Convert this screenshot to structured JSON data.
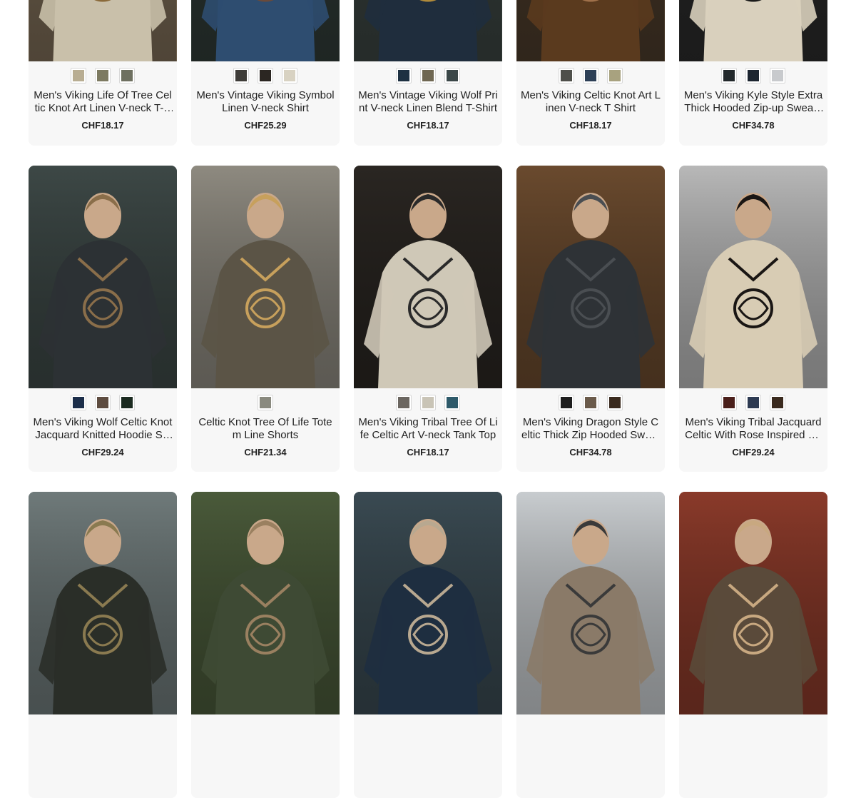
{
  "rows": [
    {
      "cards": [
        {
          "title": "Men's Viking Life Of Tree Celtic Knot Art Linen V-neck T-Shirt",
          "price": "CHF18.17",
          "swatches": [
            "#b8ad92",
            "#7d7a61",
            "#6e7060"
          ],
          "img": {
            "bg": "#7a6a55",
            "body": "#c9c0aa",
            "accent": "#8a6a3a",
            "icon": "viking-tree-linen-shirt-image"
          }
        },
        {
          "title": "Men's Vintage Viking Symbol Linen V-neck Shirt",
          "price": "CHF25.29",
          "swatches": [
            "#3e3c38",
            "#2b2622",
            "#d8d2c2"
          ],
          "img": {
            "bg": "#2f3a36",
            "body": "#2e4d70",
            "accent": "#6a4a3a",
            "icon": "viking-symbol-shirt-image"
          }
        },
        {
          "title": "Men's Vintage Viking Wolf Print V-neck Linen Blend T-Shirt",
          "price": "CHF18.17",
          "swatches": [
            "#1e3142",
            "#6f6752",
            "#3b4748"
          ],
          "img": {
            "bg": "#3a4340",
            "body": "#1f2d3d",
            "accent": "#b08a3a",
            "icon": "viking-wolf-print-shirt-image"
          }
        },
        {
          "title": "Men's Viking Celtic Knot Art Linen V-neck T Shirt",
          "price": "CHF18.17",
          "swatches": [
            "#4e4f4a",
            "#2d3f56",
            "#a8a27f"
          ],
          "img": {
            "bg": "#4a3a2a",
            "body": "#5a3a1e",
            "accent": "#a0704a",
            "icon": "viking-celtic-knot-shirt-image"
          }
        },
        {
          "title": "Men's Viking Kyle Style Extra Thick Hooded Zip-up Sweater",
          "price": "CHF34.78",
          "swatches": [
            "#22282b",
            "#1c2530",
            "#c8cacd"
          ],
          "img": {
            "bg": "#2a2a2a",
            "body": "#d9d0bd",
            "accent": "#1a1a1a",
            "icon": "viking-hooded-sweater-image"
          }
        }
      ]
    },
    {
      "cards": [
        {
          "title": "Men's Viking Wolf Celtic Knot Jacquard Knitted Hoodie Sweater",
          "price": "CHF29.24",
          "swatches": [
            "#1b2d49",
            "#5e4c40",
            "#1b2a20"
          ],
          "img": {
            "bg": "#3d4846",
            "body": "#2c3134",
            "accent": "#8a6e4a",
            "icon": "viking-wolf-hoodie-image"
          }
        },
        {
          "title": "Celtic Knot Tree Of Life Totem Line Shorts",
          "price": "CHF21.34",
          "swatches": [
            "#8a8a7f"
          ],
          "img": {
            "bg": "#8e8a80",
            "body": "#5b5446",
            "accent": "#c7a05c",
            "icon": "tree-of-life-shorts-image"
          }
        },
        {
          "title": "Men's Viking Tribal Tree Of Life Celtic Art V-neck Tank Top",
          "price": "CHF18.17",
          "swatches": [
            "#6b6660",
            "#c9c4b6",
            "#2e5a6a"
          ],
          "img": {
            "bg": "#2a2622",
            "body": "#cfc8b7",
            "accent": "#2a2a2a",
            "icon": "viking-tree-tank-top-image"
          }
        },
        {
          "title": "Men's Viking Dragon Style Celtic Thick Zip Hooded Sweater",
          "price": "CHF34.78",
          "swatches": [
            "#1e1e1e",
            "#6a5a4a",
            "#3a2a1e"
          ],
          "img": {
            "bg": "#6a4a2e",
            "body": "#2e3236",
            "accent": "#4a4e52",
            "icon": "viking-dragon-hooded-sweater-image"
          }
        },
        {
          "title": "Men's Viking Tribal Jacquard Celtic With Rose Inspired Hoodie",
          "price": "CHF29.24",
          "swatches": [
            "#4a1f1a",
            "#2d3a52",
            "#3a2a1e"
          ],
          "img": {
            "bg": "#b8b8b8",
            "body": "#d8ccb4",
            "accent": "#1a1614",
            "icon": "viking-rose-jacquard-hoodie-image"
          }
        }
      ]
    },
    {
      "cards": [
        {
          "title": "",
          "price": "",
          "swatches": [],
          "img": {
            "bg": "#6f7a7a",
            "body": "#2a2e28",
            "accent": "#8a7a50",
            "icon": "viking-hood-product-image"
          }
        },
        {
          "title": "",
          "price": "",
          "swatches": [],
          "img": {
            "bg": "#4a5a3a",
            "body": "#3e4a34",
            "accent": "#9a8060",
            "icon": "viking-shirt-on-hanger-image"
          }
        },
        {
          "title": "",
          "price": "",
          "swatches": [],
          "img": {
            "bg": "#3a4a52",
            "body": "#1e2e40",
            "accent": "#b8a890",
            "icon": "viking-blue-hoodie-image"
          }
        },
        {
          "title": "",
          "price": "",
          "swatches": [],
          "img": {
            "bg": "#c8cccf",
            "body": "#8a7a68",
            "accent": "#3a3a3a",
            "icon": "viking-snow-sweater-image"
          }
        },
        {
          "title": "",
          "price": "",
          "swatches": [],
          "img": {
            "bg": "#8a3a2a",
            "body": "#5a4a3a",
            "accent": "#c8a880",
            "icon": "viking-cabin-sweater-image"
          }
        }
      ]
    }
  ]
}
